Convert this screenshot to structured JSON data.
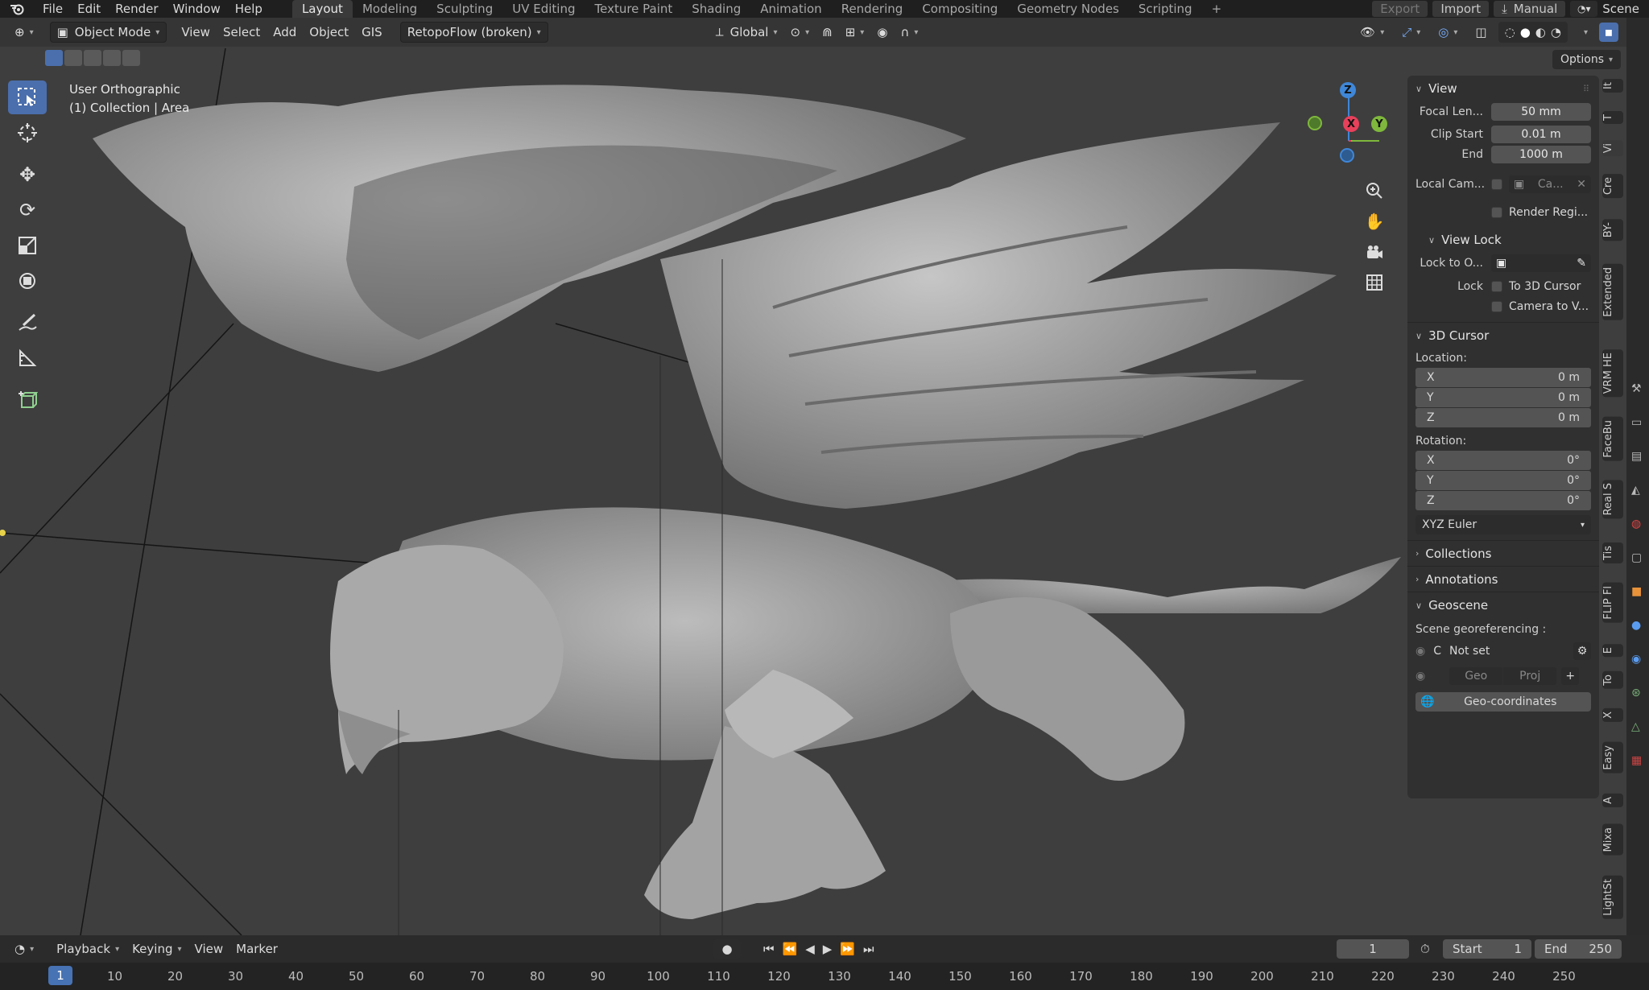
{
  "topbar": {
    "menus": [
      "File",
      "Edit",
      "Render",
      "Window",
      "Help"
    ],
    "workspaces": [
      "Layout",
      "Modeling",
      "Sculpting",
      "UV Editing",
      "Texture Paint",
      "Shading",
      "Animation",
      "Rendering",
      "Compositing",
      "Geometry Nodes",
      "Scripting"
    ],
    "add_tab": "+",
    "export_label": "Export",
    "import_label": "Import",
    "manual_label": "Manual",
    "scene_label": "Scene"
  },
  "header": {
    "mode": "Object Mode",
    "menus": [
      "View",
      "Select",
      "Add",
      "Object",
      "GIS"
    ],
    "addon_dropdown": "RetopoFlow (broken)",
    "transform_orientation": "Global",
    "options_label": "Options"
  },
  "viewport": {
    "view_name": "User Orthographic",
    "collection_info": "(1) Collection | Area",
    "gizmo": {
      "x": "X",
      "y": "Y",
      "z": "Z",
      "x_color": "#e8405b",
      "y_color": "#7fb83c",
      "z_color": "#3f87d8"
    }
  },
  "npanel": {
    "view": {
      "title": "View",
      "focal_label": "Focal Len...",
      "focal_value": "50 mm",
      "clip_start_label": "Clip Start",
      "clip_start_value": "0.01 m",
      "clip_end_label": "End",
      "clip_end_value": "1000 m",
      "local_cam_label": "Local Cam...",
      "local_cam_value": "Ca...",
      "render_region_label": "Render Regi..."
    },
    "view_lock": {
      "title": "View Lock",
      "lock_to_label": "Lock to O...",
      "lock_label": "Lock",
      "to_cursor_label": "To 3D Cursor",
      "camera_to_view_label": "Camera to V..."
    },
    "cursor": {
      "title": "3D Cursor",
      "location_label": "Location:",
      "loc": [
        {
          "axis": "X",
          "value": "0 m"
        },
        {
          "axis": "Y",
          "value": "0 m"
        },
        {
          "axis": "Z",
          "value": "0 m"
        }
      ],
      "rotation_label": "Rotation:",
      "rot": [
        {
          "axis": "X",
          "value": "0°"
        },
        {
          "axis": "Y",
          "value": "0°"
        },
        {
          "axis": "Z",
          "value": "0°"
        }
      ],
      "rotation_mode": "XYZ Euler"
    },
    "collections_title": "Collections",
    "annotations_title": "Annotations",
    "geoscene": {
      "title": "Geoscene",
      "georef_label": "Scene georeferencing :",
      "c_label": "C",
      "not_set": "Not set",
      "geo_label": "Geo",
      "proj_label": "Proj",
      "plus_label": "+",
      "geocoords_label": "Geo-coordinates"
    }
  },
  "sidebar_tabs": [
    "It",
    "T",
    "Vi",
    "Cre",
    "BY-",
    "Extended",
    "VRM HE",
    "FaceBu",
    "Real S",
    "Tis",
    "FLIP Fl",
    "E",
    "To",
    "X",
    "Easy",
    "A",
    "Mixa",
    "LightSt"
  ],
  "timeline": {
    "menus": [
      "Playback",
      "Keying",
      "View",
      "Marker"
    ],
    "current_frame": "1",
    "start_label": "Start",
    "start_value": "1",
    "end_label": "End",
    "end_value": "250",
    "ticks": [
      "1",
      "10",
      "20",
      "30",
      "40",
      "50",
      "60",
      "70",
      "80",
      "90",
      "100",
      "110",
      "120",
      "130",
      "140",
      "150",
      "160",
      "170",
      "180",
      "190",
      "200",
      "210",
      "220",
      "230",
      "240",
      "250"
    ]
  }
}
